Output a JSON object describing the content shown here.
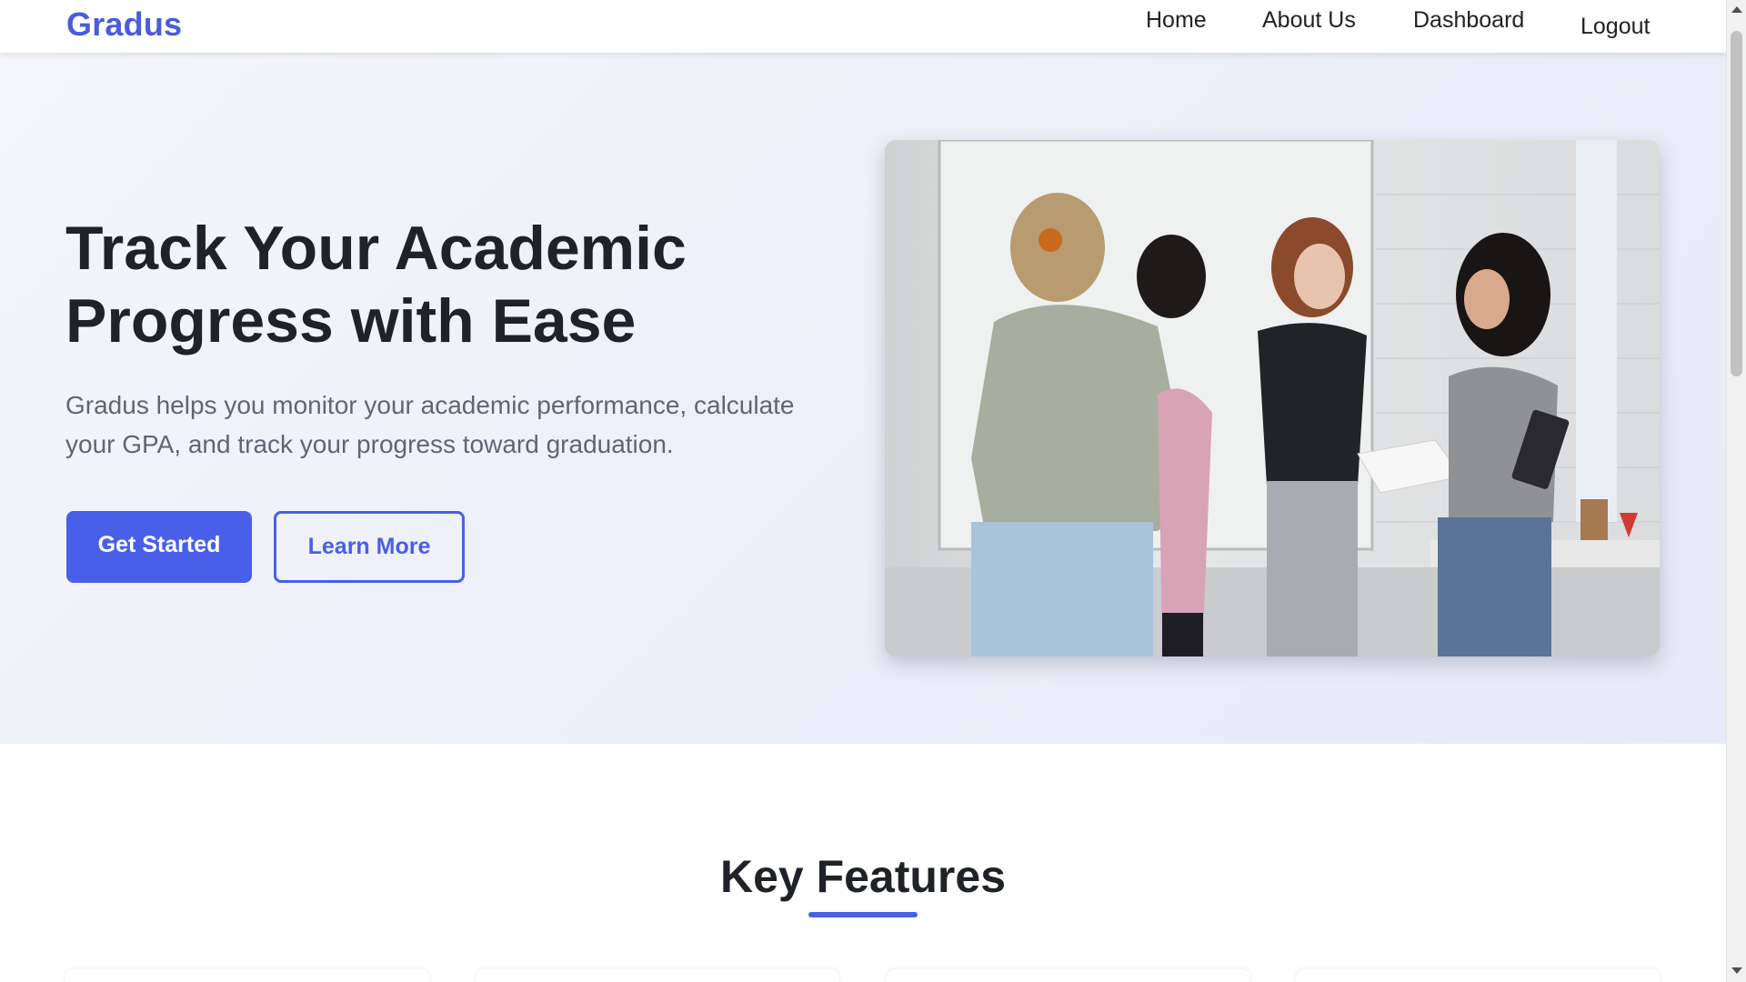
{
  "navbar": {
    "brand": "Gradus",
    "links": [
      "Home",
      "About Us",
      "Dashboard"
    ],
    "logout_label": "Logout"
  },
  "hero": {
    "title": "Track Your Academic Progress with Ease",
    "description": "Gradus helps you monitor your academic performance, calculate your GPA, and track your progress toward graduation.",
    "primary_button": "Get Started",
    "secondary_button": "Learn More",
    "image_subject": "four students standing around reviewing papers"
  },
  "features": {
    "title": "Key Features"
  },
  "colors": {
    "accent": "#4a5fe8",
    "brand": "#4a5bdc",
    "heading": "#1f2228",
    "body_text": "#5f6673",
    "hero_bg": "#eceff8"
  },
  "icons": {
    "scroll_up": "scroll-up-arrow-icon",
    "scroll_down": "scroll-down-arrow-icon"
  }
}
